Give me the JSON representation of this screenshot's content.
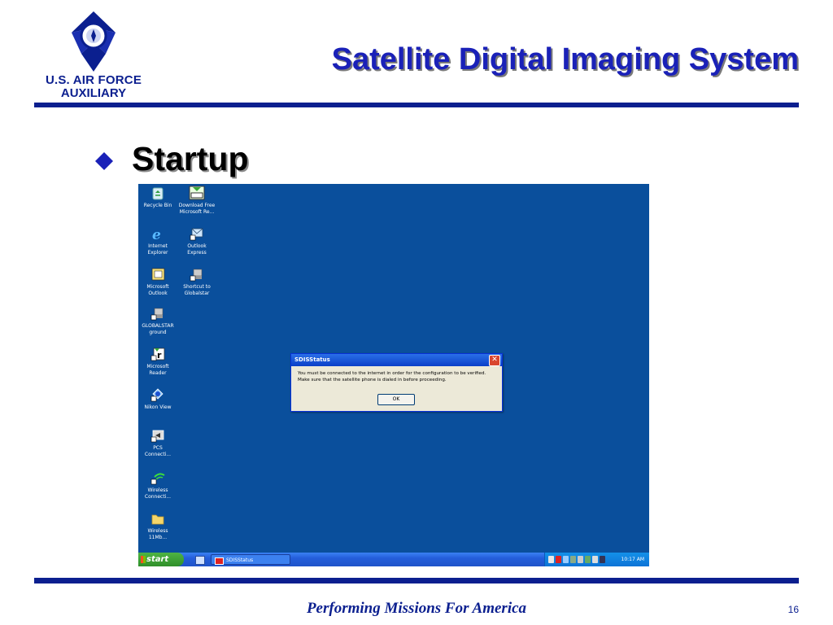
{
  "logo": {
    "line1": "U.S. AIR FORCE",
    "line2": "AUXILIARY",
    "emblem": "air-force-auxiliary-emblem"
  },
  "slide": {
    "title": "Satellite Digital Imaging System",
    "bullet": "Startup",
    "footer": "Performing Missions For America",
    "page_number": "16"
  },
  "desktop": {
    "background_color": "#0a4f9c",
    "icons": [
      {
        "label1": "Recycle Bin",
        "label2": "",
        "icon": "recycle-bin-icon"
      },
      {
        "label1": "Download Free",
        "label2": "Microsoft Re...",
        "icon": "download-reader-icon"
      },
      {
        "label1": "Internet",
        "label2": "Explorer",
        "icon": "internet-explorer-icon"
      },
      {
        "label1": "Outlook",
        "label2": "Express",
        "icon": "outlook-express-icon"
      },
      {
        "label1": "Microsoft",
        "label2": "Outlook",
        "icon": "microsoft-outlook-icon"
      },
      {
        "label1": "Shortcut to",
        "label2": "Globalstar",
        "icon": "globalstar-shortcut-icon"
      },
      {
        "label1": "GLOBALSTAR",
        "label2": "ground",
        "icon": "globalstar-ground-icon"
      },
      {
        "label1": "Microsoft",
        "label2": "Reader",
        "icon": "microsoft-reader-icon"
      },
      {
        "label1": "Nikon View",
        "label2": "",
        "icon": "nikon-view-icon"
      },
      {
        "label1": "PCS",
        "label2": "Connecti...",
        "icon": "pcs-connection-icon"
      },
      {
        "label1": "Wireless",
        "label2": "Connecti...",
        "icon": "wireless-connection-icon"
      },
      {
        "label1": "Wireless",
        "label2": "11Mb...",
        "icon": "folder-icon"
      }
    ]
  },
  "dialog": {
    "title": "SDISStatus",
    "message_line1": "You must be connected to the internet in order for the configuration to be verified.",
    "message_line2": "Make sure that the satellite phone is dialed in before proceeding.",
    "ok_label": "OK",
    "close_label": "✕"
  },
  "taskbar": {
    "start_label": "start",
    "task_label": "SDISStatus",
    "clock": "10:17 AM"
  }
}
